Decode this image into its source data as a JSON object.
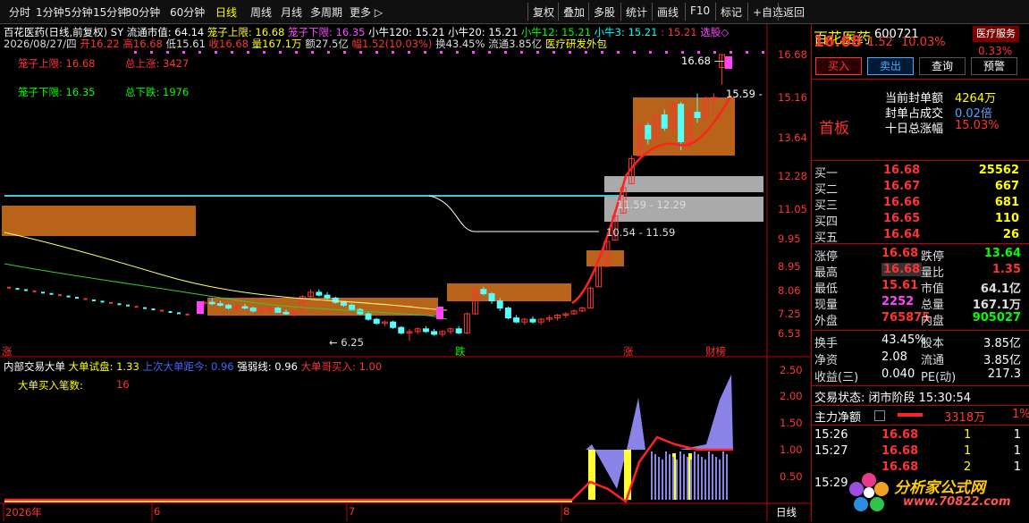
{
  "toolbar": {
    "periods": [
      "分时",
      "1分钟",
      "5分钟",
      "15分钟",
      "30分钟",
      "60分钟",
      "日线",
      "周线",
      "月线",
      "多周期",
      "更多 ▷"
    ],
    "active": "日线",
    "tools": [
      "复权",
      "叠加",
      "多股",
      "统计",
      "画线",
      "F10",
      "标记",
      "+自选",
      "返回"
    ]
  },
  "main_chart": {
    "title": "百花医药(日线,前复权)",
    "indicator_line1": [
      {
        "text": "SY",
        "color": "#ffffff"
      },
      {
        "text": "流通市值: 64.14",
        "color": "#ffffff"
      },
      {
        "text": "笼子上限: 16.68",
        "color": "#ffff00"
      },
      {
        "text": "笼子下限: 16.35",
        "color": "#ff44ff"
      },
      {
        "text": "小牛120: 15.21",
        "color": "#ffffff"
      },
      {
        "text": "小牛20: 15.21",
        "color": "#ffffff"
      },
      {
        "text": "小牛12: 15.21",
        "color": "#00ff00"
      },
      {
        "text": "小牛3: 15.21",
        "color": "#00ffff"
      },
      {
        "text": ": 15.21",
        "color": "#ff3333"
      },
      {
        "text": "选股◇",
        "color": "#ff44ff"
      }
    ],
    "info_line2": [
      {
        "text": "2026/08/27/四",
        "color": "#dddddd"
      },
      {
        "text": "开16.22",
        "color": "#ff3333"
      },
      {
        "text": "高16.68",
        "color": "#ff3333"
      },
      {
        "text": "低15.61",
        "color": "#dddddd"
      },
      {
        "text": "收16.68",
        "color": "#ff3333"
      },
      {
        "text": "量167.1万",
        "color": "#ffff00"
      },
      {
        "text": "额27.5亿",
        "color": "#dddddd"
      },
      {
        "text": "幅1.52(10.03%)",
        "color": "#ff3333"
      },
      {
        "text": "换43.45%",
        "color": "#dddddd"
      },
      {
        "text": "流通3.85亿",
        "color": "#dddddd"
      },
      {
        "text": "医疗研发外包",
        "color": "#ffff00"
      }
    ],
    "labels": {
      "cage_upper": "笼子上限: 16.68",
      "cage_lower": "笼子下限: 16.35",
      "total_up": "总上涨: 3427",
      "total_down": "总下跌: 1976"
    },
    "annotations": {
      "high": "16.68 —",
      "low": "← 6.25",
      "box_top": "15.59 -",
      "gray_top": "11.59 - 12.29",
      "gray_bottom": "10.54 - 11.59",
      "tag_die": "跌",
      "tag_zhang": "涨",
      "tag_caibang": "财榜",
      "tag_left": "涨"
    },
    "price_axis": [
      "16.68",
      "15.16",
      "13.64",
      "12.28",
      "11.05",
      "9.95",
      "8.95",
      "8.06",
      "7.25",
      "6.53"
    ]
  },
  "sub_chart": {
    "title": "内部交易大单",
    "items": [
      {
        "text": "大单试盘: 1.33",
        "color": "#ffff00"
      },
      {
        "text": "上次大单距今: 0.96",
        "color": "#4466ff"
      },
      {
        "text": "强弱线: 0.96",
        "color": "#ffffff"
      },
      {
        "text": "大单哥买入: 1.00",
        "color": "#ff3333"
      }
    ],
    "count_label": "大单买入笔数:",
    "count_value": "16",
    "axis": [
      "2.50",
      "2.00",
      "1.50",
      "1.00",
      "0.50"
    ]
  },
  "time_axis": [
    "2026年",
    "6",
    "7",
    "8"
  ],
  "period_label": "日线",
  "watermark": "分析家公式网www.70822.com",
  "right_panel": {
    "name": "百花医药",
    "code": "600721",
    "sector_badge": "医疗服务",
    "sector_pct": "0.33%",
    "price": "16.68",
    "change": "1.52",
    "change_pct": "10.03%",
    "buttons": [
      "买入",
      "卖出",
      "查询",
      "预警"
    ],
    "seal": [
      {
        "label": "当前封单额",
        "value": "4264万"
      },
      {
        "label": "封单占成交",
        "value": "0.02倍"
      },
      {
        "label": "十日总涨幅",
        "value": "15.03%"
      }
    ],
    "first_board": "首板",
    "bids": [
      {
        "label": "买一",
        "price": "16.68",
        "vol": "25562"
      },
      {
        "label": "买二",
        "price": "16.67",
        "vol": "667"
      },
      {
        "label": "买三",
        "price": "16.66",
        "vol": "681"
      },
      {
        "label": "买四",
        "price": "16.65",
        "vol": "110"
      },
      {
        "label": "买五",
        "price": "16.64",
        "vol": "26"
      }
    ],
    "stats": [
      {
        "l1": "涨停",
        "v1": "16.68",
        "c1": "#ff3333",
        "l2": "跌停",
        "v2": "13.64",
        "c2": "#00ff00"
      },
      {
        "l1": "最高",
        "v1": "16.68",
        "c1": "#ff3333",
        "l2": "量比",
        "v2": "1.35",
        "c2": "#ff3333"
      },
      {
        "l1": "最低",
        "v1": "15.61",
        "c1": "#ff3333",
        "l2": "市值",
        "v2": "64.1亿",
        "c2": "#dddddd"
      },
      {
        "l1": "现量",
        "v1": "2252",
        "c1": "#ff44ff",
        "l2": "总量",
        "v2": "167.1万",
        "c2": "#dddddd"
      },
      {
        "l1": "外盘",
        "v1": "765875",
        "c1": "#ff3333",
        "l2": "内盘",
        "v2": "905027",
        "c2": "#00ff00"
      }
    ],
    "stats2": [
      {
        "l1": "换手",
        "v1": "43.45%",
        "l2": "股本",
        "v2": "3.85亿"
      },
      {
        "l1": "净资",
        "v1": "2.08",
        "l2": "流通",
        "v2": "3.85亿"
      },
      {
        "l1": "收益(三)",
        "v1": "0.040",
        "l2": "PE(动)",
        "v2": "217.3"
      }
    ],
    "trade_status": "交易状态: 闭市阶段 15:30:54",
    "main_net_label": "主力净额",
    "main_net_value": "3318万",
    "main_net_pct": "1%",
    "ticks": [
      {
        "time": "15:26",
        "price": "16.68",
        "vol": "1",
        "n": "1"
      },
      {
        "time": "15:27",
        "price": "16.68",
        "vol": "1",
        "n": "1"
      },
      {
        "time": "",
        "price": "16.68",
        "vol": "2",
        "n": "1"
      },
      {
        "time": "15:29",
        "price": "",
        "vol": "",
        "n": ""
      }
    ],
    "logo_text": "分析家公式网",
    "logo_url": "www.70822.com"
  },
  "chart_data": {
    "type": "candlestick",
    "price_axis_ticks": [
      16.68,
      15.16,
      13.64,
      12.28,
      11.05,
      9.95,
      8.95,
      8.06,
      7.25,
      6.53
    ],
    "x_labels": [
      "2026年",
      "6",
      "7",
      "8"
    ],
    "candles": [
      [
        7.6,
        7.7,
        7.5,
        7.65
      ],
      [
        7.65,
        7.8,
        7.55,
        7.6
      ],
      [
        7.6,
        7.7,
        7.5,
        7.55
      ],
      [
        7.55,
        7.6,
        7.4,
        7.45
      ],
      [
        7.45,
        7.55,
        7.35,
        7.5
      ],
      [
        7.5,
        7.6,
        7.4,
        7.45
      ],
      [
        7.45,
        7.5,
        7.3,
        7.35
      ],
      [
        7.35,
        7.45,
        7.25,
        7.4
      ],
      [
        7.4,
        7.5,
        7.3,
        7.45
      ],
      [
        7.45,
        7.5,
        7.3,
        7.3
      ],
      [
        7.3,
        7.4,
        7.2,
        7.25
      ],
      [
        7.25,
        7.35,
        7.15,
        7.3
      ],
      [
        7.35,
        7.9,
        7.3,
        7.85
      ],
      [
        7.85,
        8.1,
        7.8,
        8.0
      ],
      [
        8.0,
        8.1,
        7.85,
        7.9
      ],
      [
        7.9,
        8.0,
        7.75,
        7.8
      ],
      [
        7.8,
        7.85,
        7.6,
        7.65
      ],
      [
        7.65,
        7.7,
        7.5,
        7.55
      ],
      [
        7.55,
        7.6,
        7.35,
        7.4
      ],
      [
        7.4,
        7.45,
        7.2,
        7.25
      ],
      [
        7.25,
        7.3,
        7.0,
        7.05
      ],
      [
        7.05,
        7.1,
        6.85,
        6.9
      ],
      [
        6.9,
        7.0,
        6.8,
        6.95
      ],
      [
        6.95,
        7.0,
        6.7,
        6.75
      ],
      [
        6.75,
        6.8,
        6.5,
        6.55
      ],
      [
        6.55,
        6.7,
        6.25,
        6.6
      ],
      [
        6.6,
        6.75,
        6.5,
        6.7
      ],
      [
        6.7,
        6.8,
        6.55,
        6.6
      ],
      [
        6.6,
        6.7,
        6.45,
        6.5
      ],
      [
        6.5,
        6.65,
        6.4,
        6.6
      ],
      [
        6.6,
        6.75,
        6.5,
        6.7
      ],
      [
        6.7,
        6.8,
        6.5,
        6.55
      ],
      [
        6.55,
        7.3,
        6.5,
        7.25
      ],
      [
        7.25,
        8.2,
        7.2,
        8.1
      ],
      [
        8.1,
        8.2,
        7.9,
        7.95
      ],
      [
        7.95,
        8.0,
        7.6,
        7.7
      ],
      [
        7.7,
        7.8,
        7.35,
        7.45
      ],
      [
        7.45,
        7.5,
        7.05,
        7.1
      ],
      [
        7.1,
        7.2,
        6.9,
        6.95
      ],
      [
        6.95,
        7.1,
        6.85,
        7.05
      ],
      [
        7.05,
        7.15,
        6.9,
        6.95
      ],
      [
        6.95,
        7.1,
        6.85,
        7.05
      ],
      [
        7.05,
        7.2,
        6.95,
        7.1
      ],
      [
        7.1,
        7.25,
        7.0,
        7.2
      ],
      [
        7.2,
        7.3,
        7.1,
        7.25
      ],
      [
        7.25,
        7.4,
        7.2,
        7.35
      ],
      [
        7.35,
        7.5,
        7.3,
        7.45
      ],
      [
        7.45,
        8.2,
        7.45,
        8.15
      ],
      [
        8.2,
        9.0,
        8.2,
        8.95
      ],
      [
        8.95,
        9.9,
        8.95,
        9.85
      ],
      [
        9.9,
        10.85,
        9.9,
        10.8
      ],
      [
        10.9,
        11.9,
        10.9,
        11.85
      ],
      [
        12.0,
        13.0,
        12.0,
        12.9
      ],
      [
        13.0,
        14.2,
        13.0,
        14.1
      ],
      [
        14.1,
        14.2,
        13.4,
        13.6
      ],
      [
        13.6,
        14.6,
        13.5,
        14.5
      ],
      [
        14.5,
        14.7,
        13.9,
        14.0
      ],
      [
        14.0,
        15.0,
        13.8,
        14.9
      ],
      [
        14.9,
        15.0,
        13.2,
        13.5
      ],
      [
        13.5,
        14.7,
        13.3,
        14.6
      ],
      [
        14.6,
        15.3,
        14.2,
        14.4
      ],
      [
        14.4,
        15.2,
        14.3,
        15.1
      ],
      [
        15.1,
        15.3,
        14.6,
        15.16
      ],
      [
        16.22,
        16.68,
        15.61,
        16.68
      ]
    ]
  }
}
